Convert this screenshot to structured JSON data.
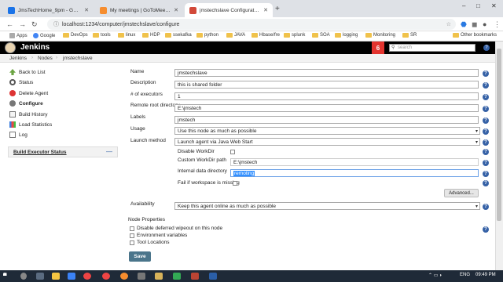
{
  "browser": {
    "tabs": [
      {
        "label": "JmsTechHome_9pm - Google Dr",
        "favicon_color": "#1a73e8"
      },
      {
        "label": "My meetings | GoToMeeting",
        "favicon_color": "#f68d2e"
      },
      {
        "label": "jmstechslave Configuration [Jenk",
        "favicon_color": "#d24939"
      }
    ],
    "new_tab": "+",
    "window_controls": [
      "–",
      "□",
      "✕"
    ],
    "url": "localhost:1234/computer/jmstechslave/configure",
    "bookmarks": [
      "Apps",
      "Google",
      "DevOps",
      "tools",
      "linux",
      "HDP",
      "ssekafka",
      "python",
      "JAVA",
      "Hbase/fre",
      "splunk",
      "SOA",
      "logging",
      "Monitoring",
      "SR"
    ],
    "other_bookmarks": "Other bookmarks"
  },
  "jenkins": {
    "title": "Jenkins",
    "notification_count": "6",
    "search_placeholder": "search",
    "breadcrumbs": [
      "Jenkins",
      "Nodes",
      "jmstechslave"
    ]
  },
  "sidebar": {
    "items": [
      {
        "label": "Back to List",
        "icon": "arrow-up-icon"
      },
      {
        "label": "Status",
        "icon": "magnifier-icon"
      },
      {
        "label": "Delete Agent",
        "icon": "delete-icon"
      },
      {
        "label": "Configure",
        "icon": "gear-icon"
      },
      {
        "label": "Build History",
        "icon": "notepad-icon"
      },
      {
        "label": "Load Statistics",
        "icon": "chart-icon"
      },
      {
        "label": "Log",
        "icon": "document-icon"
      }
    ],
    "executor_status": "Build Executor Status",
    "collapse": "—"
  },
  "form": {
    "name_label": "Name",
    "name_value": "jmstechslave",
    "description_label": "Description",
    "description_value": "this is shared folder",
    "executors_label": "# of executors",
    "executors_value": "1",
    "root_label": "Remote root directory",
    "root_value": "E:\\jmstech",
    "labels_label": "Labels",
    "labels_value": "jmstech",
    "usage_label": "Usage",
    "usage_value": "Use this node as much as possible",
    "launch_label": "Launch method",
    "launch_value": "Launch agent via Java Web Start",
    "disable_workdir": "Disable WorkDir",
    "custom_workdir_label": "Custom WorkDir path",
    "custom_workdir_value": "E:\\jmstech",
    "internal_dir_label": "Internal data directory",
    "internal_dir_value": "remoting",
    "fail_missing": "Fail if workspace is missing",
    "advanced": "Advanced...",
    "availability_label": "Availability",
    "availability_value": "Keep this agent online as much as possible",
    "node_properties": "Node Properties",
    "props": [
      "Disable deferred wipeout on this node",
      "Environment variables",
      "Tool Locations"
    ],
    "save": "Save"
  },
  "taskbar": {
    "lang": "ENG",
    "time": "09:49 PM"
  }
}
